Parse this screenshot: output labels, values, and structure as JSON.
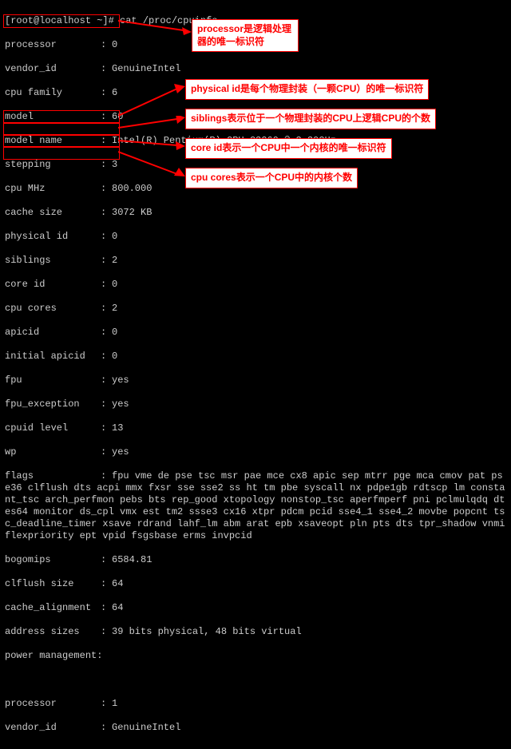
{
  "prompt": "[root@localhost ~]# cat /proc/cpuinfo",
  "rows": {
    "processor": {
      "k": "processor",
      "v": "0"
    },
    "vendor_id": {
      "k": "vendor_id",
      "v": "GenuineIntel"
    },
    "cpu_family": {
      "k": "cpu family",
      "v": "6"
    },
    "model": {
      "k": "model",
      "v": "60"
    },
    "model_name": {
      "k": "model name",
      "v": "Intel(R) Pentium(R) CPU G3260 @ 3.30GHz"
    },
    "stepping": {
      "k": "stepping",
      "v": "3"
    },
    "cpu_mhz": {
      "k": "cpu MHz",
      "v": "800.000"
    },
    "cache_size": {
      "k": "cache size",
      "v": "3072 KB"
    },
    "physical_id": {
      "k": "physical id",
      "v": "0"
    },
    "siblings": {
      "k": "siblings",
      "v": "2"
    },
    "core_id": {
      "k": "core id",
      "v": "0"
    },
    "cpu_cores": {
      "k": "cpu cores",
      "v": "2"
    },
    "apicid": {
      "k": "apicid",
      "v": "0"
    },
    "initial_apicid": {
      "k": "initial apicid",
      "v": "0"
    },
    "fpu": {
      "k": "fpu",
      "v": "yes"
    },
    "fpu_exception": {
      "k": "fpu_exception",
      "v": "yes"
    },
    "cpuid_level": {
      "k": "cpuid level",
      "v": "13"
    },
    "wp": {
      "k": "wp",
      "v": "yes"
    },
    "bogomips": {
      "k": "bogomips",
      "v": "6584.81"
    },
    "clflush_size": {
      "k": "clflush size",
      "v": "64"
    },
    "cache_alignment": {
      "k": "cache_alignment",
      "v": "64"
    },
    "address_sizes": {
      "k": "address sizes",
      "v": "39 bits physical, 48 bits virtual"
    },
    "power_mgmt": {
      "k": "power management:",
      "v": ""
    },
    "processor2": {
      "k": "processor",
      "v": "1"
    },
    "vendor_id2": {
      "k": "vendor_id",
      "v": "GenuineIntel"
    }
  },
  "flags_label": "flags",
  "flags_value": "fpu vme de pse tsc msr pae mce cx8 apic sep mtrr pge mca cmov pat pse36 clflush dts acpi mmx fxsr sse sse2 ss ht tm pbe syscall nx pdpe1gb rdtscp lm constant_tsc arch_perfmon pebs bts rep_good xtopology nonstop_tsc aperfmperf pni pclmulqdq dtes64 monitor ds_cpl vmx est tm2 ssse3 cx16 xtpr pdcm pcid sse4_1 sse4_2 movbe popcnt tsc_deadline_timer xsave rdrand lahf_lm abm arat epb xsaveopt pln pts dts tpr_shadow vnmi flexpriority ept vpid fsgsbase erms invpcid",
  "annotations": {
    "a1": "processor是逻辑处理器的唯一标识符",
    "a2": "physical id是每个物理封装（一颗CPU）的唯一标识符",
    "a3": "siblings表示位于一个物理封装的CPU上逻辑CPU的个数",
    "a4": "core id表示一个CPU中一个内核的唯一标识符",
    "a5": "cpu cores表示一个CPU中的内核个数"
  }
}
